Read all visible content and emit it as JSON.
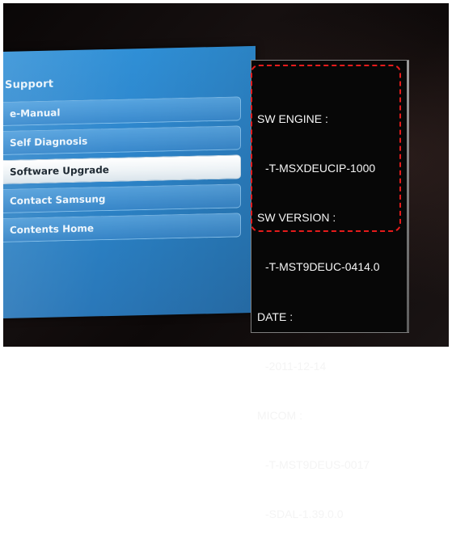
{
  "menu": {
    "title": "Support",
    "items": [
      {
        "label": "e-Manual",
        "selected": false
      },
      {
        "label": "Self Diagnosis",
        "selected": false
      },
      {
        "label": "Software Upgrade",
        "selected": true
      },
      {
        "label": "Contact Samsung",
        "selected": false
      },
      {
        "label": "Contents Home",
        "selected": false
      }
    ]
  },
  "info": {
    "sw_engine_label": "SW ENGINE :",
    "sw_engine_value": "-T-MSXDEUCIP-1000",
    "sw_version_label": "SW VERSION :",
    "sw_version_value": "-T-MST9DEUC-0414.0",
    "date_label": "DATE :",
    "date_value": "-2011-12-14",
    "micom_label": "MICOM :",
    "micom_value_1": "-T-MST9DEUS-0017",
    "micom_value_2": "-SDAL-1.39.0.0"
  },
  "colors": {
    "menu_blue": "#2e86cc",
    "selected_item": "#ffffff",
    "highlight_border": "#e51b1b",
    "info_background": "#070707"
  }
}
